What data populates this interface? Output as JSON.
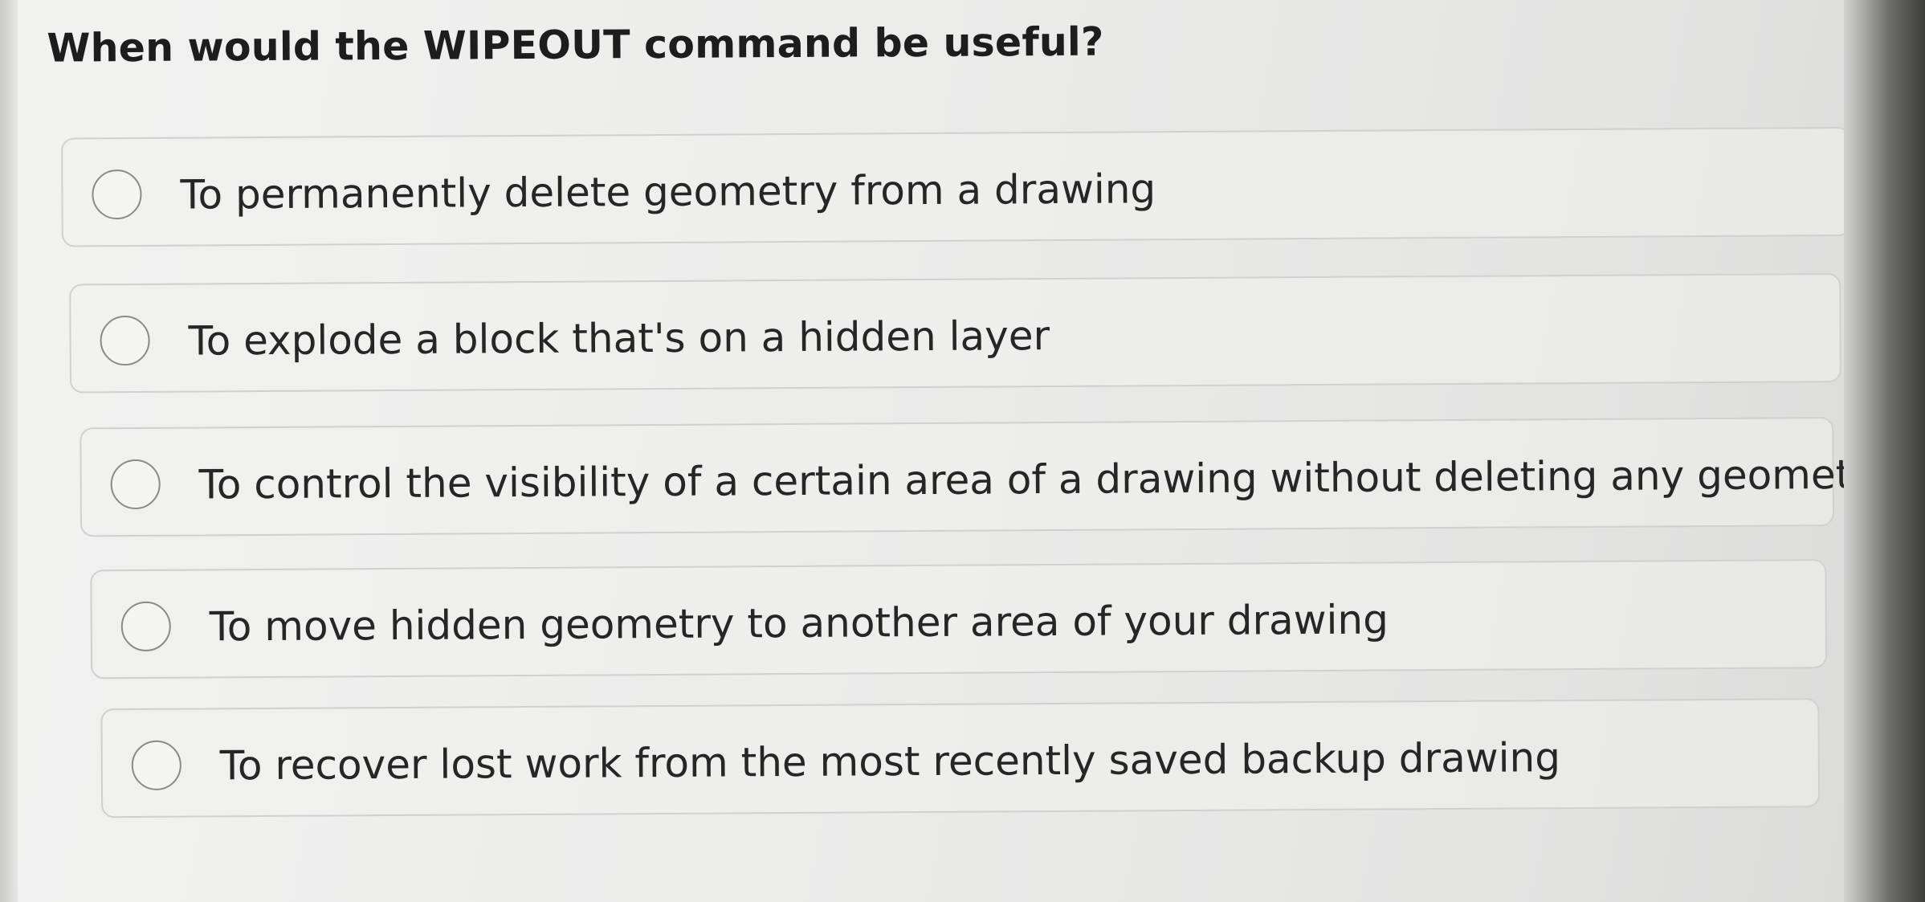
{
  "question": {
    "text": "When would the WIPEOUT command be useful?"
  },
  "options": [
    {
      "label": "To permanently delete geometry from a drawing",
      "selected": false
    },
    {
      "label": "To explode a block that's on a hidden layer",
      "selected": false
    },
    {
      "label": "To control the visibility of a certain area of a drawing without deleting any geometry",
      "selected": false
    },
    {
      "label": "To move hidden geometry to another area of your drawing",
      "selected": false
    },
    {
      "label": "To recover lost work from the most recently saved backup drawing",
      "selected": false
    }
  ]
}
